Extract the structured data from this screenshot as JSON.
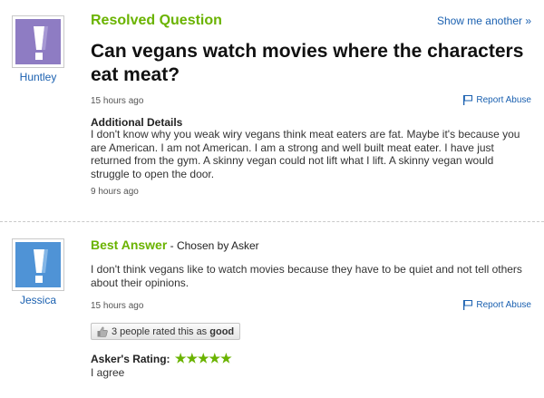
{
  "question": {
    "status_label": "Resolved Question",
    "show_another": "Show me another »",
    "title": "Can vegans watch movies where the characters eat meat?",
    "asker": "Huntley",
    "posted": "15 hours ago",
    "report": "Report Abuse",
    "details_title": "Additional Details",
    "details_body": "I don't know why you weak wiry vegans think meat eaters are fat. Maybe it's because you are American. I am not American. I am a strong and well built meat eater. I have just returned from the gym. A skinny vegan could not lift what I lift. A skinny vegan would struggle to open the door.",
    "details_time": "9 hours ago",
    "avatar_color": "#8e7cc3"
  },
  "answer": {
    "best_label": "Best Answer",
    "chosen_by": " - Chosen by Asker",
    "answerer": "Jessica",
    "body": "I don't think vegans like to watch movies because they have to be quiet and not tell others about their opinions.",
    "posted": "15 hours ago",
    "report": "Report Abuse",
    "rating_prefix": "3 people rated this as ",
    "rating_word": "good",
    "askers_rating_label": "Asker's Rating:",
    "stars": "★★★★★",
    "stars_value": 5,
    "comment": "I agree",
    "avatar_color": "#4f93d6"
  },
  "icons": {
    "flag": "flag-icon",
    "thumb": "thumbs-up-icon",
    "avatar": "exclamation-avatar-icon"
  }
}
